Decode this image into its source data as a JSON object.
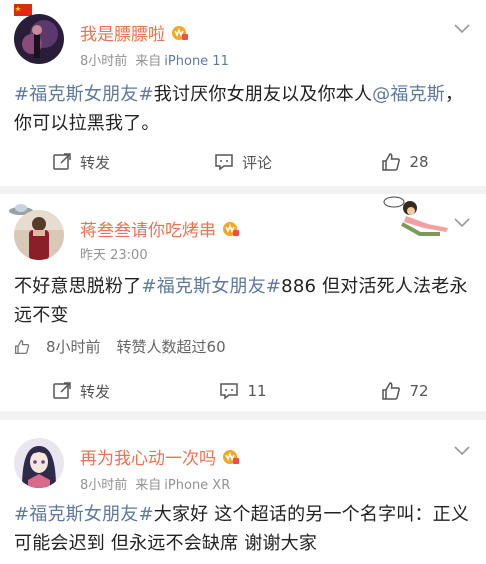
{
  "posts": [
    {
      "username": "我是膘膘啦",
      "time": "8小时前",
      "source_prefix": "来自",
      "source": "iPhone 11",
      "body": [
        {
          "type": "tag",
          "text": "#福克斯女朋友#"
        },
        {
          "type": "text",
          "text": "我讨厌你女朋友以及你本人"
        },
        {
          "type": "mention",
          "text": "@福克斯"
        },
        {
          "type": "text",
          "text": "，你可以拉黑我了。"
        }
      ],
      "actions": {
        "repost": "转发",
        "comment": "评论",
        "like": "28"
      }
    },
    {
      "username": "蒋叁叁请你吃烤串",
      "time": "昨天 23:00",
      "body": [
        {
          "type": "text",
          "text": "不好意思脱粉了"
        },
        {
          "type": "tag",
          "text": "#福克斯女朋友#"
        },
        {
          "type": "text",
          "text": "886 但对活死人法老永远不变"
        }
      ],
      "likes_row": {
        "time": "8小时前",
        "text": "转赞人数超过60"
      },
      "actions": {
        "repost": "转发",
        "comment": "11",
        "like": "72"
      }
    },
    {
      "username": "再为我心动一次吗",
      "time": "8小时前",
      "source_prefix": "来自",
      "source": "iPhone XR",
      "body": [
        {
          "type": "tag",
          "text": "#福克斯女朋友#"
        },
        {
          "type": "text",
          "text": "大家好 这个超话的另一个名字叫：正义可能会迟到 但永远不会缺席 谢谢大家"
        }
      ]
    }
  ],
  "colors": {
    "username": "#eb7350",
    "link": "#5d7a9f",
    "meta": "#939393"
  }
}
